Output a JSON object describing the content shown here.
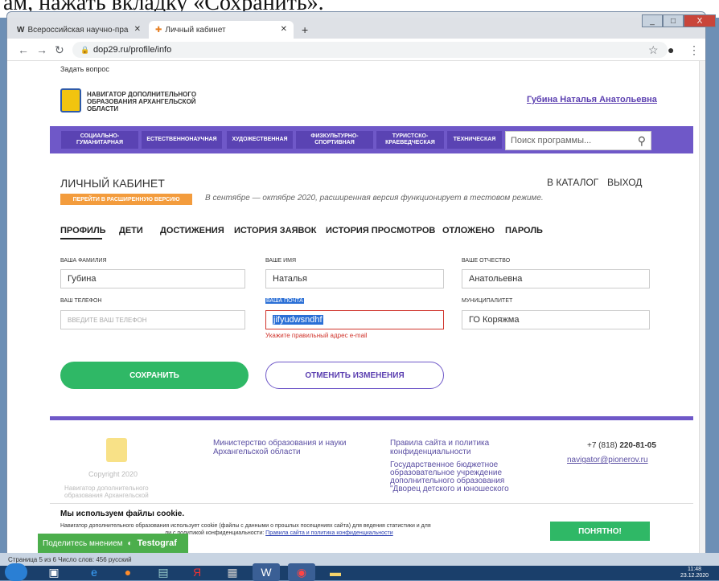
{
  "doc_fragment": "ам, нажать вкладку «Сохранить».",
  "browser": {
    "tabs": [
      {
        "label": "Всероссийская научно-пра"
      },
      {
        "label": "Личный кабинет"
      }
    ],
    "url": "dop29.ru/profile/info",
    "window_buttons": {
      "minimize": "_",
      "maximize": "□",
      "close": "X"
    }
  },
  "site": {
    "ask_link": "Задать вопрос",
    "brand": "НАВИГАТОР ДОПОЛНИТЕЛЬНОГО ОБРАЗОВАНИЯ АРХАНГЕЛЬСКОЙ ОБЛАСТИ",
    "user_name": "Губина Наталья Анатольевна",
    "menu": [
      "СОЦИАЛЬНО-ГУМАНИТАРНАЯ",
      "ЕСТЕСТВЕННОНАУЧНАЯ",
      "ХУДОЖЕСТВЕННАЯ",
      "ФИЗКУЛЬТУРНО-СПОРТИВНАЯ",
      "ТУРИСТСКО-КРАЕВЕДЧЕСКАЯ",
      "ТЕХНИЧЕСКАЯ"
    ],
    "search_placeholder": "Поиск программы...",
    "cabinet_title": "ЛИЧНЫЙ КАБИНЕТ",
    "to_catalog": "В КАТАЛОГ",
    "logout": "ВЫХОД",
    "extended_button": "ПЕРЕЙТИ В РАСШИРЕННУЮ ВЕРСИЮ",
    "extended_note": "В сентябре — октябре 2020, расширенная версия функционирует в тестовом режиме.",
    "profile_tabs": [
      "ПРОФИЛЬ",
      "ДЕТИ",
      "ДОСТИЖЕНИЯ",
      "ИСТОРИЯ ЗАЯВОК",
      "ИСТОРИЯ ПРОСМОТРОВ",
      "ОТЛОЖЕНО",
      "ПАРОЛЬ"
    ],
    "form": {
      "surname_label": "ВАША ФАМИЛИЯ",
      "surname": "Губина",
      "name_label": "ВАШЕ ИМЯ",
      "name": "Наталья",
      "patronymic_label": "ВАШЕ ОТЧЕСТВО",
      "patronymic": "Анатольевна",
      "phone_label": "ВАШ ТЕЛЕФОН",
      "phone_placeholder": "ВВЕДИТЕ ВАШ ТЕЛЕФОН",
      "email_label": "ВАША ПОЧТА",
      "email": "jifyudwsndhf",
      "email_error": "Укажите правильный адрес e-mail",
      "municipality_label": "МУНИЦИПАЛИТЕТ",
      "municipality": "ГО Коряжма"
    },
    "save": "СОХРАНИТЬ",
    "cancel": "ОТМЕНИТЬ ИЗМЕНЕНИЯ",
    "footer": {
      "copyright": "Copyright 2020",
      "navigator": "Навигатор дополнительного образования Архангельской",
      "ministry": "Министерство образования и науки Архангельской области",
      "rules": "Правила сайта и политика конфиденциальности",
      "org": "Государственное бюджетное образовательное учреждение дополнительного образования \"Дворец детского и юношеского",
      "phone_prefix": "+7 (818) ",
      "phone_number": "220-81-05",
      "email": "navigator@pionerov.ru"
    },
    "cookie": {
      "title": "Мы используем файлы cookie.",
      "text": "Навигатор дополнительного образования использует cookie (файлы с данными о прошлых посещениях сайта) для ведения статистики и для",
      "text2": "ли с политикой конфиденциальности:",
      "link": "Правила сайта и политика конфиденциальности",
      "ok": "ПОНЯТНО!"
    },
    "testograf": {
      "label": "Поделитесь мнением",
      "brand": "Testograf"
    }
  },
  "status_bar": "Страница 5 из 6   Число слов: 456   русский",
  "clock": {
    "time": "11:48",
    "date": "23.12.2020"
  }
}
